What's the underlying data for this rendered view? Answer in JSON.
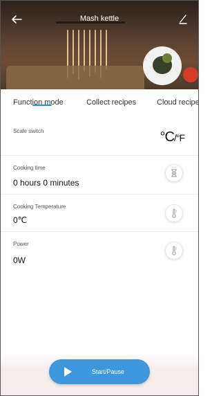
{
  "header": {
    "title": "Mash kettle"
  },
  "tabs": [
    {
      "label": "Function mode",
      "active": true
    },
    {
      "label": "Collect recipes",
      "active": false
    },
    {
      "label": "Cloud recipe",
      "active": false
    }
  ],
  "scale": {
    "label": "Scale switch",
    "unit_c": "°C",
    "unit_f": "/°F"
  },
  "cooking_time": {
    "label": "Cooking time",
    "value": "0 hours 0 minutes",
    "icon": "hourglass-icon"
  },
  "cooking_temperature": {
    "label": "Cooking Temperature",
    "value": "0℃",
    "icon": "thermometer-icon"
  },
  "power": {
    "label": "Power",
    "value": "0W",
    "icon": "thermometer-icon"
  },
  "action": {
    "start_pause_label": "Start/Pause"
  },
  "colors": {
    "accent": "#3d97dc",
    "tab_underline": "#2f8fd8"
  }
}
